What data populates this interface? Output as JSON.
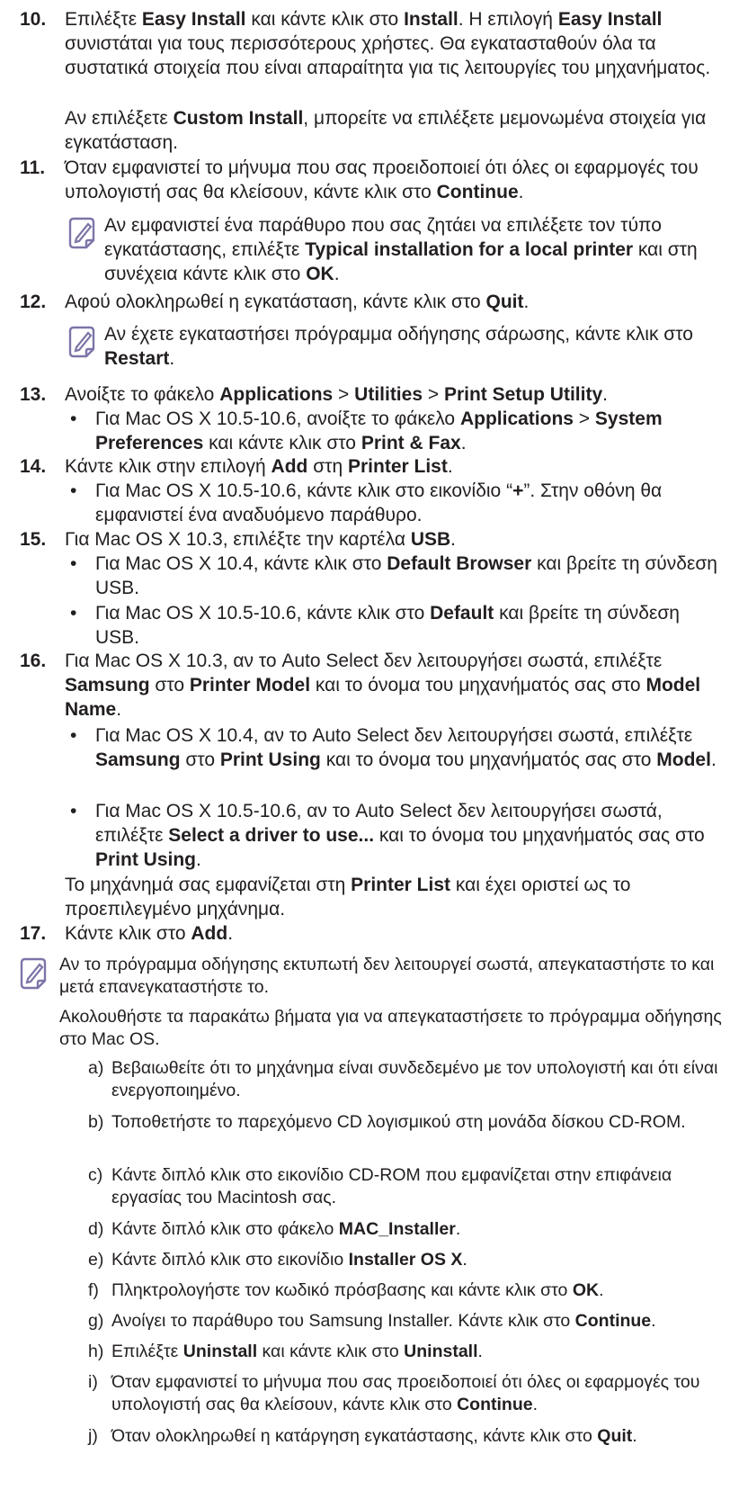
{
  "step10": {
    "num": "10.",
    "line1_a": "Επιλέξτε ",
    "line1_b": "Easy Install",
    "line1_c": " και κάντε κλικ στο ",
    "line1_d": "Install",
    "line1_e": ". Η επιλογή ",
    "line1_f": "Easy Install",
    "line2": " συνιστάται για τους περισσότερους χρήστες. Θα εγκατασταθούν όλα τα συστατικά στοιχεία που είναι απαραίτητα για τις λειτουργίες του μηχανήματος.",
    "para_a": "Αν επιλέξετε ",
    "para_b": "Custom Install",
    "para_c": ", μπορείτε να επιλέξετε μεμονωμένα στοιχεία για εγκατάσταση."
  },
  "step11": {
    "num": "11.",
    "a": "Όταν εμφανιστεί το μήνυμα που σας προειδοποιεί ότι όλες οι εφαρμογές του υπολογιστή σας θα κλείσουν, κάντε κλικ στο ",
    "b": "Continue",
    "c": ".",
    "note_a": "Αν εμφανιστεί ένα παράθυρο που σας ζητάει να επιλέξετε τον τύπο εγκατάστασης, επιλέξτε ",
    "note_b": "Typical installation for a local printer",
    "note_c": " και στη συνέχεια κάντε κλικ στο ",
    "note_d": "OK",
    "note_e": "."
  },
  "step12": {
    "num": "12.",
    "a": "Αφού ολοκληρωθεί η εγκατάσταση, κάντε κλικ στο ",
    "b": "Quit",
    "c": ".",
    "note_a": "Αν έχετε εγκαταστήσει πρόγραμμα οδήγησης σάρωσης, κάντε κλικ στο ",
    "note_b": "Restart",
    "note_c": "."
  },
  "step13": {
    "num": "13.",
    "a": "Ανοίξτε το φάκελο ",
    "b": "Applications",
    "c": " > ",
    "d": "Utilities",
    "e": " > ",
    "f": "Print Setup Utility",
    "g": ".",
    "bullet_a": "Για Mac OS X 10.5-10.6, ανοίξτε το φάκελο ",
    "bullet_b": "Applications",
    "bullet_c": " > ",
    "bullet_d": "System Preferences",
    "bullet_e": " και κάντε κλικ στο ",
    "bullet_f": "Print & Fax",
    "bullet_g": "."
  },
  "step14": {
    "num": "14.",
    "a": "Κάντε κλικ στην επιλογή ",
    "b": "Add",
    "c": " στη ",
    "d": "Printer List",
    "e": ".",
    "bullet_a": "Για Mac OS X 10.5-10.6, κάντε κλικ στο εικονίδιο “",
    "bullet_b": "+",
    "bullet_c": "”. Στην οθόνη θα εμφανιστεί ένα αναδυόμενο παράθυρο."
  },
  "step15": {
    "num": "15.",
    "a": "Για Mac OS X 10.3, επιλέξτε την καρτέλα ",
    "b": "USB",
    "c": ".",
    "b1_a": "Για Mac OS X 10.4, κάντε κλικ στο ",
    "b1_b": "Default Browser",
    "b1_c": " και βρείτε τη σύνδεση USB.",
    "b2_a": "Για Mac OS X 10.5-10.6, κάντε κλικ στο ",
    "b2_b": "Default",
    "b2_c": " και βρείτε τη σύνδεση USB."
  },
  "step16": {
    "num": "16.",
    "a": "Για Mac OS X 10.3, αν το Auto Select δεν λειτουργήσει σωστά, επιλέξτε ",
    "b": "Samsung",
    "c": " στο ",
    "d": "Printer Model",
    "e": " και το όνομα του μηχανήματός σας στο ",
    "f": "Model Name",
    "g": ".",
    "b1_a": "Για Mac OS X 10.4, αν το Auto Select δεν λειτουργήσει σωστά, επιλέξτε ",
    "b1_b": "Samsung",
    "b1_c": " στο ",
    "b1_d": "Print Using",
    "b1_e": " και το όνομα του μηχανήματός σας στο ",
    "b1_f": "Model",
    "b1_g": ".",
    "b2_a": "Για Mac OS X 10.5-10.6, αν το Auto Select δεν λειτουργήσει σωστά, επιλέξτε ",
    "b2_b": "Select a driver to use...",
    "b2_c": " και το όνομα του μηχανήματός σας στο ",
    "b2_d": "Print Using",
    "b2_e": ".",
    "para_a": "Το μηχάνημά σας εμφανίζεται στη ",
    "para_b": "Printer List",
    "para_c": " και έχει οριστεί ως το προεπιλεγμένο μηχάνημα."
  },
  "step17": {
    "num": "17.",
    "a": "Κάντε κλικ στο ",
    "b": "Add",
    "c": "."
  },
  "final_note": {
    "p1": "Αν το πρόγραμμα οδήγησης εκτυπωτή δεν λειτουργεί σωστά, απεγκαταστήστε το και μετά επανεγκαταστήστε το.",
    "p2": "Ακολουθήστε τα παρακάτω βήματα για να απεγκαταστήσετε το πρόγραμμα οδήγησης στο Mac OS.",
    "items": [
      {
        "letter": "a)",
        "a": "Βεβαιωθείτε ότι το μηχάνημα είναι συνδεδεμένο με τον υπολογιστή και ότι είναι ενεργοποιημένο.",
        "b": "",
        "c": ""
      },
      {
        "letter": "b)",
        "a": "Τοποθετήστε το παρεχόμενο CD λογισμικού στη μονάδα δίσκου CD-ROM.",
        "b": "",
        "c": ""
      },
      {
        "letter": "c)",
        "a": "Κάντε διπλό κλικ στο εικονίδιο CD-ROM που εμφανίζεται στην επιφάνεια εργασίας του Macintosh σας.",
        "b": "",
        "c": ""
      },
      {
        "letter": "d)",
        "a": "Κάντε διπλό κλικ στο φάκελο ",
        "b": "MAC_Installer",
        "c": "."
      },
      {
        "letter": "e)",
        "a": "Κάντε διπλό κλικ στο εικονίδιο ",
        "b": "Installer OS X",
        "c": "."
      },
      {
        "letter": "f)",
        "a": "Πληκτρολογήστε τον κωδικό πρόσβασης και κάντε κλικ στο ",
        "b": "OK",
        "c": "."
      },
      {
        "letter": "g)",
        "a": "Ανοίγει το παράθυρο του Samsung Installer. Κάντε κλικ στο ",
        "b": "Continue",
        "c": "."
      },
      {
        "letter": "h)",
        "a": "Επιλέξτε ",
        "b": "Uninstall",
        "c": " και κάντε κλικ στο ",
        "d": "Uninstall",
        "e": "."
      },
      {
        "letter": "i)",
        "a": "Όταν εμφανιστεί το μήνυμα που σας προειδοποιεί ότι όλες οι εφαρμογές του υπολογιστή σας θα κλείσουν, κάντε κλικ στο ",
        "b": "Continue",
        "c": "."
      },
      {
        "letter": "j)",
        "a": "Όταν ολοκληρωθεί η κατάρ­γηση εγκατάστασης, κάντε κλικ στο ",
        "b": "Quit",
        "c": "."
      }
    ]
  },
  "colors": {
    "text": "#231f20",
    "note_icon": "#7b75a8"
  },
  "icons": {
    "note": "note-pencil-icon"
  }
}
